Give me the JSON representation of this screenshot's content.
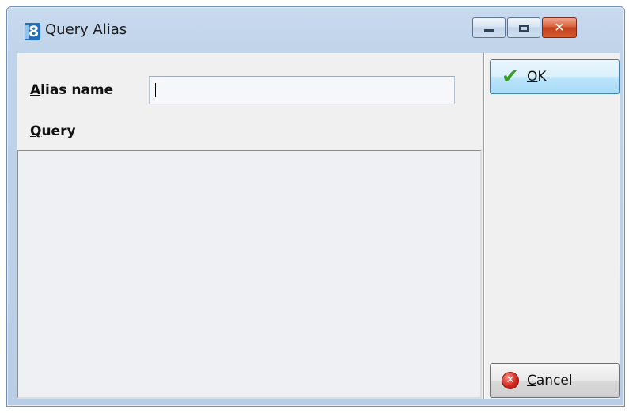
{
  "window": {
    "title": "Query Alias",
    "app_icon_glyph": "8",
    "controls": {
      "minimize_icon": "minimize-icon",
      "maximize_icon": "maximize-icon",
      "close_glyph": "✕"
    }
  },
  "form": {
    "alias_label_accel": "A",
    "alias_label_rest": "lias name",
    "alias_value": "",
    "query_label_accel": "Q",
    "query_label_rest": "uery",
    "query_value": ""
  },
  "buttons": {
    "ok_accel": "O",
    "ok_rest": "K",
    "ok_icon": "check-icon",
    "cancel_accel": "C",
    "cancel_rest": "ancel",
    "cancel_icon": "cancel-icon"
  },
  "colors": {
    "ok_check": "#3a9d23",
    "cancel_red": "#d0241c",
    "app_icon_blue": "#1f6fbf"
  }
}
